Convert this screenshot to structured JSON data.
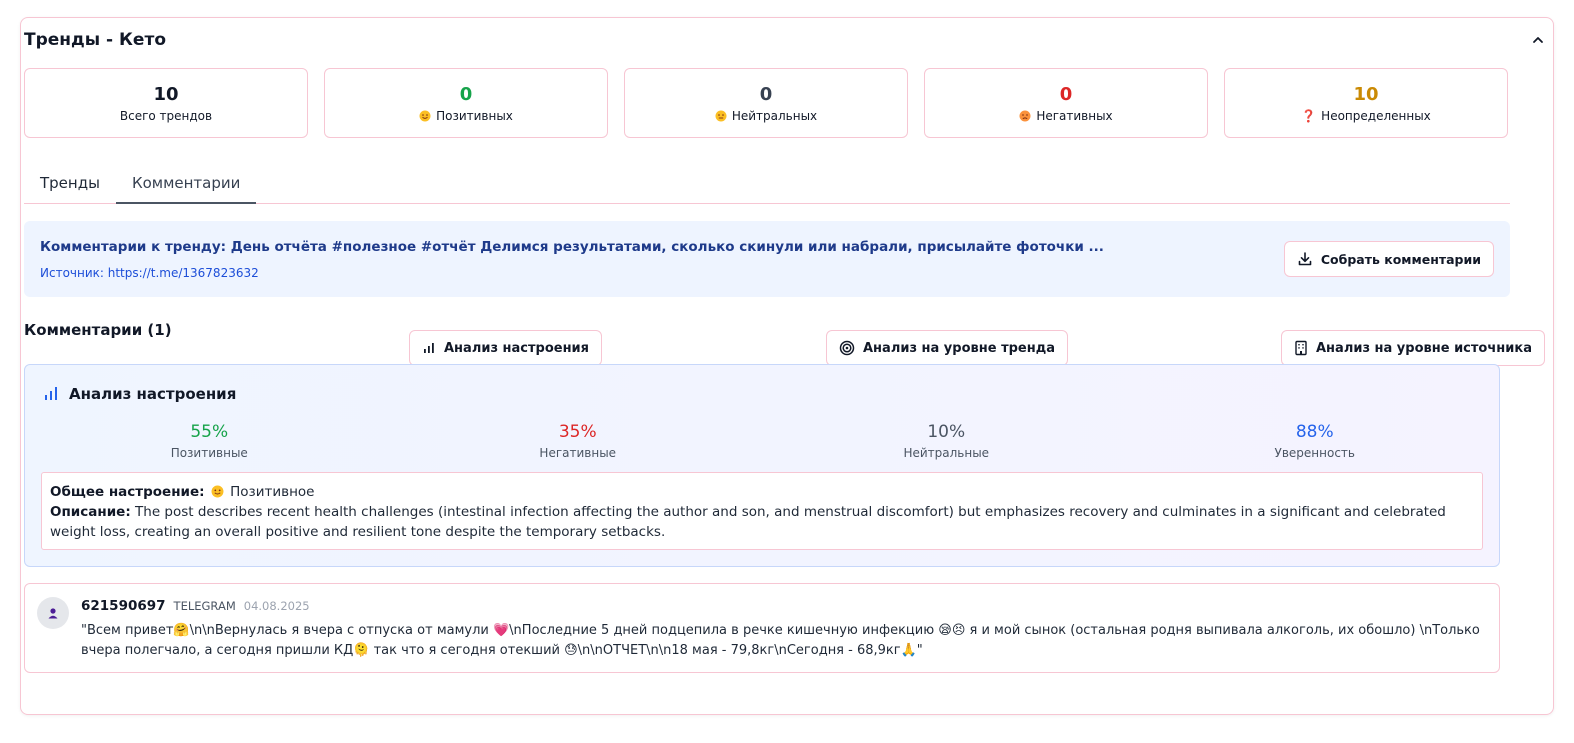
{
  "header": {
    "title": "Тренды - Кето"
  },
  "stats": [
    {
      "value": "10",
      "label": "Всего трендов",
      "color": "#111827",
      "icon": ""
    },
    {
      "value": "0",
      "label": "Позитивных",
      "color": "#16a34a",
      "icon": "smile-emoji"
    },
    {
      "value": "0",
      "label": "Нейтральных",
      "color": "#374151",
      "icon": "neutral-emoji"
    },
    {
      "value": "0",
      "label": "Негативных",
      "color": "#dc2626",
      "icon": "sad-emoji"
    },
    {
      "value": "10",
      "label": "Неопределенных",
      "color": "#ca8a04",
      "icon": "question-mark"
    }
  ],
  "stat_question_glyph": "❓",
  "tabs": [
    {
      "label": "Тренды"
    },
    {
      "label": "Комментарии",
      "active": true
    }
  ],
  "banner": {
    "title": "Комментарии к тренду: День отчёта #полезное #отчёт Делимся результатами, сколько скинули или набрали, присылайте фоточки ...",
    "source": "Источник: https://t.me/1367823632",
    "collect_button": "Собрать комментарии"
  },
  "comments_section": {
    "title": "Комментарии (1)",
    "sentiment_button": "Анализ настроения",
    "trend_button": "Анализ на уровне тренда",
    "source_button": "Анализ на уровне источника"
  },
  "analysis": {
    "title": "Анализ настроения",
    "metrics": [
      {
        "value": "55%",
        "label": "Позитивные",
        "color": "#16a34a"
      },
      {
        "value": "35%",
        "label": "Негативные",
        "color": "#dc2626"
      },
      {
        "value": "10%",
        "label": "Нейтральные",
        "color": "#4b5563"
      },
      {
        "value": "88%",
        "label": "Уверенность",
        "color": "#2563eb"
      }
    ],
    "overall_label": "Общее настроение:",
    "overall_value": "Позитивное",
    "description_label": "Описание:",
    "description": "The post describes recent health challenges (intestinal infection affecting the author and son, and menstrual discomfort) but emphasizes recovery and culminates in a significant and celebrated weight loss, creating an overall positive and resilient tone despite the temporary setbacks."
  },
  "comment": {
    "author": "621590697",
    "platform": "TELEGRAM",
    "date": "04.08.2025",
    "text": "\"Всем привет🤗\\n\\nВернулась я вчера с отпуска от мамули 💗\\nПоследние 5 дней подцепила в речке кишечную инфекцию 😪😣 я и мой сынок (остальная родня выпивала алкоголь, их обошло) \\nТолько вчера полегчало, а сегодня пришли КД🫠 так что я сегодня отекший 😓\\n\\nОТЧЕТ\\n\\n18 мая - 79,8кг\\nСегодня - 68,9кг🙏\""
  }
}
